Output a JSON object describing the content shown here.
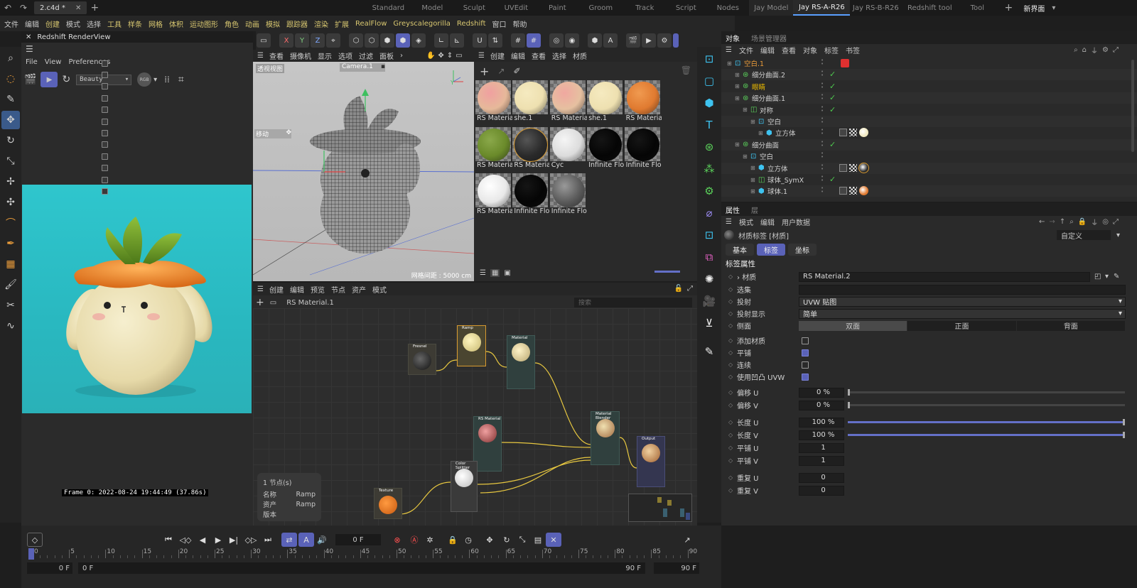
{
  "topbar": {
    "file_tab": "2.c4d *",
    "layouts": [
      "Standard",
      "Model",
      "Sculpt",
      "UVEdit",
      "Paint",
      "Groom",
      "Track",
      "Script",
      "Nodes",
      "Jay Model",
      "Jay RS-A-R26",
      "Jay RS-B-R26",
      "Redshift tool",
      "Tool"
    ],
    "active_layout": "Jay RS-A-R26",
    "new_ui": "新界面"
  },
  "menubar": {
    "items": [
      "文件",
      "编辑",
      "创建",
      "模式",
      "选择",
      "工具",
      "样条",
      "网格",
      "体积",
      "运动图形",
      "角色",
      "动画",
      "模拟",
      "跟踪器",
      "渲染",
      "扩展",
      "RealFlow",
      "Greyscalegorilla",
      "Redshift",
      "窗口",
      "帮助"
    ]
  },
  "renderview": {
    "title": "Redshift RenderView",
    "menu": [
      "File",
      "View",
      "Preferences"
    ],
    "aov": "Beauty",
    "rgb": "RGB",
    "frame_info": "Frame  0:  2022-08-24  19:44:49  (37.86s)"
  },
  "viewport": {
    "menu": [
      "查看",
      "摄像机",
      "显示",
      "选项",
      "过滤",
      "面板"
    ],
    "view_label": "透视视图",
    "camera": "Camera.1",
    "move_label": "移动",
    "grid_info": "网格间距 : 5000 cm"
  },
  "materials": {
    "menu": [
      "创建",
      "编辑",
      "查看",
      "选择",
      "材质"
    ],
    "items": [
      {
        "name": "RS Materia",
        "color": "#e6b99a",
        "accent": "#f0a0a0"
      },
      {
        "name": "she.1",
        "color": "#eee0b0",
        "accent": "#f5eac0"
      },
      {
        "name": "RS Materia",
        "color": "#e6c0a0",
        "accent": "#f0a8a0"
      },
      {
        "name": "she.1",
        "color": "#eee0b0",
        "accent": "#f5eac0"
      },
      {
        "name": "RS Materia",
        "color": "#e07a30",
        "accent": "#f09a50"
      },
      {
        "name": "RS Materia",
        "color": "#6a8a2a",
        "accent": "#8aa84a"
      },
      {
        "name": "RS Materia",
        "color": "#2a2a2a",
        "accent": "#555"
      },
      {
        "name": "Cyc",
        "color": "#dcdcdc",
        "accent": "#f5f5f5"
      },
      {
        "name": "Infinite Flo",
        "color": "#050505",
        "accent": "#151515"
      },
      {
        "name": "Infinite Flo",
        "color": "#050505",
        "accent": "#151515"
      },
      {
        "name": "RS Materia",
        "color": "#e8e8e8",
        "accent": "#fff"
      },
      {
        "name": "Infinite Flo",
        "color": "#050505",
        "accent": "#151515"
      },
      {
        "name": "Infinite Flo",
        "color": "#5a5a5a",
        "accent": "#999"
      }
    ]
  },
  "node_editor": {
    "menu": [
      "创建",
      "编辑",
      "预览",
      "节点",
      "资产",
      "模式"
    ],
    "material_name": "RS Material.1",
    "search_placeholder": "搜索",
    "info": {
      "count": "1 节点(s)",
      "rows": [
        [
          "名称",
          "Ramp"
        ],
        [
          "资产",
          "Ramp"
        ],
        [
          "版本",
          ""
        ]
      ]
    },
    "nodes": {
      "fresnel": "Fresnel",
      "ramp": "Ramp",
      "material": "Material",
      "rs_material": "RS Material",
      "color_splitter": "Color Splitter",
      "material_blender": "Material Blender",
      "output": "Output",
      "texture": "Texture"
    }
  },
  "objects": {
    "tabs": [
      "对象",
      "场景管理器"
    ],
    "menu": [
      "文件",
      "编辑",
      "查看",
      "对象",
      "标签",
      "书签"
    ],
    "rows": [
      {
        "name": "空白.1",
        "indent": 0,
        "color": "#e89b3a",
        "check": false,
        "tag": "red"
      },
      {
        "name": "细分曲面.2",
        "indent": 1,
        "color": "#d0d0d0",
        "check": true
      },
      {
        "name": "眼睛",
        "indent": 1,
        "color": "#e8b800",
        "check": true
      },
      {
        "name": "细分曲面.1",
        "indent": 1,
        "color": "#d0d0d0",
        "check": true
      },
      {
        "name": "对称",
        "indent": 2,
        "color": "#d0d0d0",
        "check": true
      },
      {
        "name": "空白",
        "indent": 3,
        "color": "#d0d0d0",
        "check": false
      },
      {
        "name": "立方体",
        "indent": 4,
        "color": "#d0d0d0",
        "check": false,
        "tag": "mat1"
      },
      {
        "name": "细分曲面",
        "indent": 1,
        "color": "#d0d0d0",
        "check": true
      },
      {
        "name": "空白",
        "indent": 2,
        "color": "#d0d0d0",
        "check": false
      },
      {
        "name": "立方体",
        "indent": 3,
        "color": "#d0d0d0",
        "check": false,
        "tag": "mat2"
      },
      {
        "name": "球体_SymX",
        "indent": 3,
        "color": "#d0d0d0",
        "check": true
      },
      {
        "name": "球体.1",
        "indent": 3,
        "color": "#d0d0d0",
        "check": false,
        "tag": "mat3"
      }
    ]
  },
  "attributes": {
    "tabs": [
      "属性",
      "层"
    ],
    "menu": [
      "模式",
      "编辑",
      "用户数据"
    ],
    "title": "材质标签 [材质]",
    "preset": "自定义",
    "subtabs": [
      "基本",
      "标签",
      "坐标"
    ],
    "active_subtab": "标签",
    "section": "标签属性",
    "material_label": "材质",
    "material_value": "RS Material.2",
    "selection_label": "选集",
    "projection_label": "投射",
    "projection_value": "UVW 贴图",
    "proj_display_label": "投射显示",
    "proj_display_value": "简单",
    "side_label": "侧面",
    "side_options": [
      "双面",
      "正面",
      "背面"
    ],
    "add_mat_label": "添加材质",
    "tile_label": "平铺",
    "seamless_label": "连续",
    "bump_uvw_label": "使用凹凸 UVW",
    "offset_u_label": "偏移 U",
    "offset_u": "0 %",
    "offset_u_level": 0,
    "offset_v_label": "偏移 V",
    "offset_v": "0 %",
    "offset_v_level": 0,
    "length_u_label": "长度 U",
    "length_u": "100 %",
    "length_u_level": 100,
    "length_v_label": "长度 V",
    "length_v": "100 %",
    "length_v_level": 100,
    "tile_u_label": "平铺 U",
    "tile_u": "1",
    "tile_v_label": "平铺 V",
    "tile_v": "1",
    "repeat_u_label": "重复 U",
    "repeat_u": "0",
    "repeat_v_label": "重复 V",
    "repeat_v": "0"
  },
  "timeline": {
    "current_frame": "0 F",
    "ticks": [
      "0",
      "5",
      "10",
      "15",
      "20",
      "25",
      "30",
      "35",
      "40",
      "45",
      "50",
      "55",
      "60",
      "65",
      "70",
      "75",
      "80",
      "85",
      "90"
    ],
    "start": "0 F",
    "min": "0 F",
    "max": "90 F",
    "end": "90 F"
  }
}
